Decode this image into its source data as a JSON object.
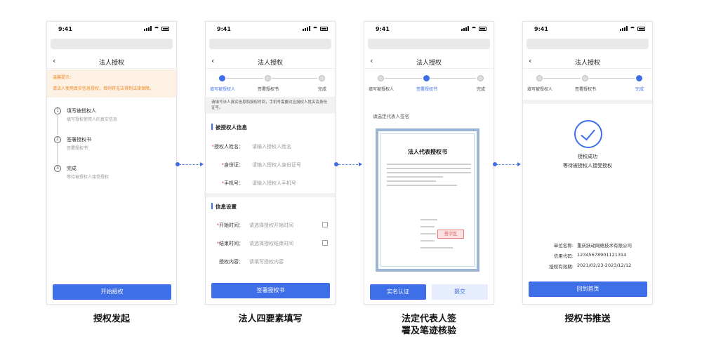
{
  "status_time": "9:41",
  "captions": [
    "授权发起",
    "法人四要素填写",
    "法定代表人签署及笔迹核验",
    "授权书推送"
  ],
  "caption3_lines": [
    "法定代表人签",
    "署及笔迹核验"
  ],
  "phone1": {
    "title": "法人授权",
    "warn_title": "温馨提示：",
    "warn_text": "请法人使用真实信息授权，否则将无法得到法律保障。",
    "steps": [
      {
        "num": "1",
        "title": "填写被授权人",
        "desc": "填写授权使用人的真实信息"
      },
      {
        "num": "2",
        "title": "签署授权书",
        "desc": "签署授权书"
      },
      {
        "num": "3",
        "title": "完成",
        "desc": "等待被授权人接受授权"
      }
    ],
    "button": "开始授权"
  },
  "phone2": {
    "title": "法人授权",
    "steps": [
      "填写被授权人",
      "签署授权书",
      "完成"
    ],
    "note": "请填写法人真实信息和授权时间，手机号需要对应授权人姓名及身份证号。",
    "section1": "被授权人信息",
    "fields1": [
      {
        "label": "授权人姓名：",
        "placeholder": "请输入授权人姓名"
      },
      {
        "label": "身份证：",
        "placeholder": "请输入授权人身份证号"
      },
      {
        "label": "手机号：",
        "placeholder": "请输入授权人手机号"
      }
    ],
    "section2": "信息设置",
    "fields2": [
      {
        "label": "开始时间：",
        "placeholder": "请选择授权开始时间"
      },
      {
        "label": "结束时间：",
        "placeholder": "请选择授权结束时间"
      },
      {
        "label": "授权内容：",
        "placeholder": "请填写授权内容"
      }
    ],
    "req": "*",
    "button": "签署授权书"
  },
  "phone3": {
    "title": "法人授权",
    "steps": [
      "填写被授权人",
      "签署授权书",
      "完成"
    ],
    "prompt": "请选定代表人签名",
    "doc_title": "法人代表授权书",
    "stamp": "签字区",
    "btn_verify": "实名认证",
    "btn_submit": "提交"
  },
  "phone4": {
    "title": "法人授权",
    "steps": [
      "填写被授权人",
      "签署授权书",
      "完成"
    ],
    "success": "授权成功",
    "waiting": "等待被授权人接受授权",
    "info": [
      {
        "label": "单位名称:",
        "value": "重庆跃动网络技术有限公司"
      },
      {
        "label": "信用代码:",
        "value": "12345678901121314"
      },
      {
        "label": "授权有效期:",
        "value": "2021/02/23-2023/12/12"
      }
    ],
    "button": "回到首页"
  },
  "colors": {
    "primary": "#3e6fe8",
    "warning": "#f08a24"
  }
}
